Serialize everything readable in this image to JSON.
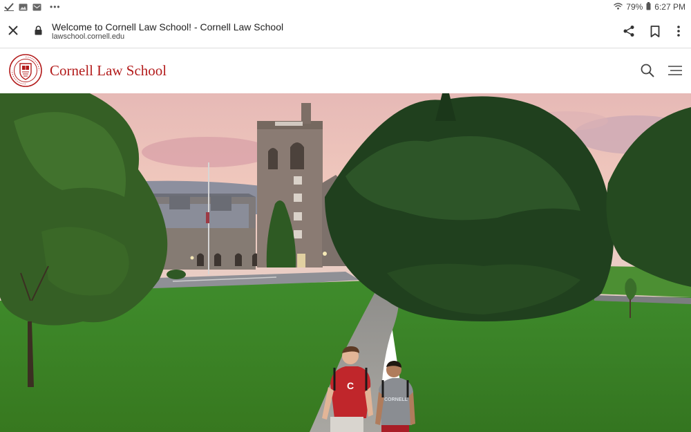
{
  "statusbar": {
    "left_icons": [
      "check-icon",
      "image-icon",
      "mail-icon",
      "more-dots-icon"
    ],
    "battery": "79%",
    "time": "6:27 PM"
  },
  "browser": {
    "page_title": "Welcome to Cornell Law School! - Cornell Law School",
    "url": "lawschool.cornell.edu",
    "icons": [
      "close-icon",
      "lock-icon",
      "share-icon",
      "bookmark-icon",
      "more-vert-icon"
    ]
  },
  "site": {
    "brand": "Cornell Law School",
    "accent": "#b31b1b",
    "icons": [
      "cornell-seal-icon",
      "search-icon",
      "menu-icon"
    ]
  },
  "hero": {
    "scene": "campus-video-still",
    "shirt_letter": "C",
    "shirt2_text": "CORNELL"
  }
}
